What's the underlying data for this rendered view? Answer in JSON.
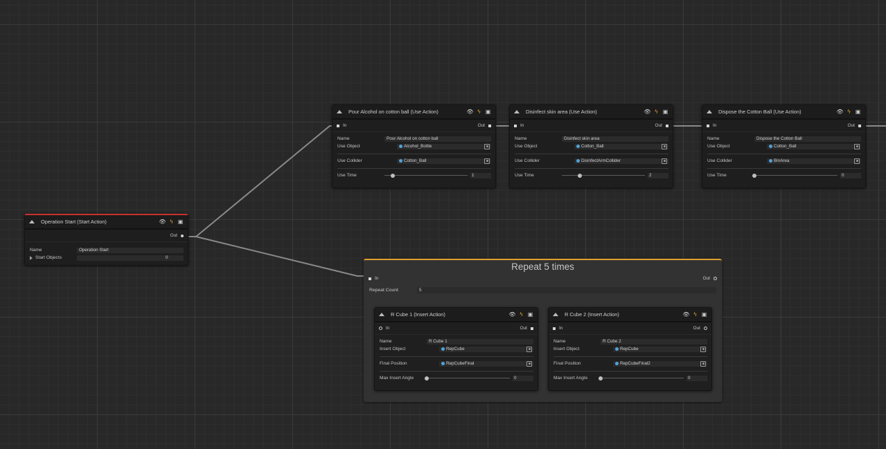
{
  "nodes": {
    "start": {
      "title": "Operation Start (Start Action)",
      "out_label": "Out",
      "name_label": "Name",
      "name_value": "Operation Start",
      "start_objects_label": "Start Objects",
      "start_objects_value": "0"
    },
    "pour": {
      "title": "Pour Alcohol on cotton ball (Use Action)",
      "in_label": "In",
      "out_label": "Out",
      "name_label": "Name",
      "name_value": "Pour Alcohol on cotton ball",
      "use_object_label": "Use Object",
      "use_object_value": "Alcohol_Bottle",
      "use_collider_label": "Use Collider",
      "use_collider_value": "Cotton_Ball",
      "use_time_label": "Use Time",
      "use_time_value": "1",
      "use_time_fraction": 0.1
    },
    "disinfect": {
      "title": "Disinfect skin area (Use Action)",
      "in_label": "In",
      "out_label": "Out",
      "name_label": "Name",
      "name_value": "Disinfect skin area",
      "use_object_label": "Use Object",
      "use_object_value": "Cotton_Ball",
      "use_collider_label": "Use Collider",
      "use_collider_value": "DisinfectArmCollider",
      "use_time_label": "Use Time",
      "use_time_value": "2",
      "use_time_fraction": 0.22
    },
    "dispose": {
      "title": "Dispose the Cotton Ball (Use Action)",
      "in_label": "In",
      "out_label": "Out",
      "name_label": "Name",
      "name_value": "Dispose the Cotton Ball",
      "use_object_label": "Use Object",
      "use_object_value": "Cotton_Ball",
      "use_collider_label": "Use Collider",
      "use_collider_value": "BinArea",
      "use_time_label": "Use Time",
      "use_time_value": "0",
      "use_time_fraction": 0.0
    },
    "cube1": {
      "title": "R Cube 1 (Insert Action)",
      "in_label": "In",
      "out_label": "Out",
      "name_label": "Name",
      "name_value": "R Cube 1",
      "insert_object_label": "Insert Object",
      "insert_object_value": "RepCube",
      "final_position_label": "Final Position",
      "final_position_value": "RepCubeFinal",
      "max_angle_label": "Max Insert Angle",
      "max_angle_value": "0",
      "max_angle_fraction": 0.0
    },
    "cube2": {
      "title": "R Cube 2 (Insert Action)",
      "in_label": "In",
      "out_label": "Out",
      "name_label": "Name",
      "name_value": "R Cube 2",
      "insert_object_label": "Insert Object",
      "insert_object_value": "RepCube",
      "final_position_label": "Final Position",
      "final_position_value": "RepCubeFinal2",
      "max_angle_label": "Max Insert Angle",
      "max_angle_value": "0",
      "max_angle_fraction": 0.0
    }
  },
  "group": {
    "title": "Repeat 5 times",
    "in_label": "In",
    "out_label": "Out",
    "repeat_count_label": "Repeat Count",
    "repeat_count_value": "5"
  },
  "icons": [
    "eye-icon",
    "bolt-icon",
    "save-icon",
    "collapse-icon",
    "object-icon",
    "target-icon"
  ],
  "colors": {
    "background": "#282828",
    "node": "#1e1e1e",
    "start_accent": "#c8322e",
    "group_accent": "#e0a030",
    "bolt": "#e2a22f",
    "object_icon": "#4fa3d8"
  }
}
